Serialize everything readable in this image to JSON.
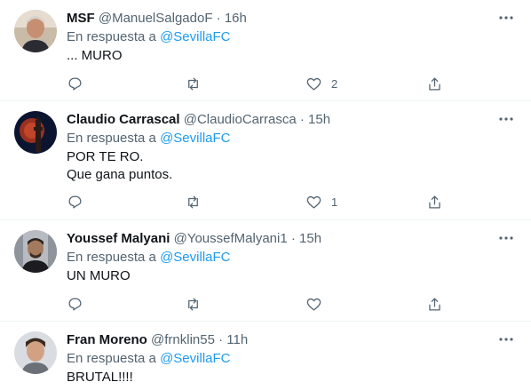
{
  "tweets": [
    {
      "name": "MSF",
      "handle": "@ManuelSalgadoF",
      "separator": "·",
      "time": "16h",
      "reply_prefix": "En respuesta a",
      "reply_to": "@SevillaFC",
      "lines": [
        "... MURO"
      ],
      "likes": "2",
      "avatar_icon": "portrait-icon"
    },
    {
      "name": "Claudio Carrascal",
      "handle": "@ClaudioCarrasca",
      "separator": "·",
      "time": "15h",
      "reply_prefix": "En respuesta a",
      "reply_to": "@SevillaFC",
      "lines": [
        "POR TE RO.",
        "Que gana puntos."
      ],
      "likes": "1",
      "avatar_icon": "tower-icon"
    },
    {
      "name": "Youssef Malyani",
      "handle": "@YoussefMalyani1",
      "separator": "·",
      "time": "15h",
      "reply_prefix": "En respuesta a",
      "reply_to": "@SevillaFC",
      "lines": [
        "UN MURO"
      ],
      "likes": "",
      "avatar_icon": "portrait-icon"
    },
    {
      "name": "Fran Moreno",
      "handle": "@frnklin55",
      "separator": "·",
      "time": "11h",
      "reply_prefix": "En respuesta a",
      "reply_to": "@SevillaFC",
      "lines": [
        "BRUTAL!!!!"
      ],
      "likes": "",
      "avatar_icon": "portrait-icon"
    }
  ],
  "icons": {
    "more": "more-icon",
    "reply": "reply-icon",
    "retweet": "retweet-icon",
    "like": "heart-icon",
    "share": "share-icon"
  },
  "colors": {
    "text": "#0f1419",
    "secondary": "#536471",
    "link": "#1d9bf0",
    "divider": "#eff3f4"
  }
}
